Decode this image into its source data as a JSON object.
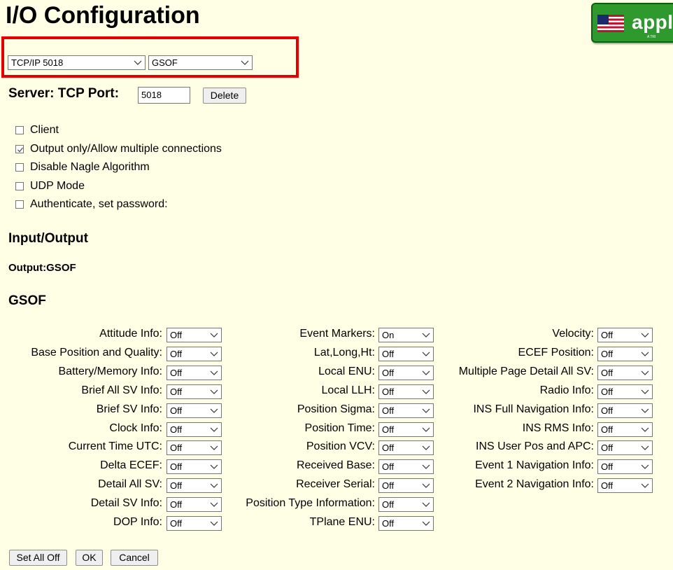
{
  "title": "I/O Configuration",
  "logo": {
    "text": "appl",
    "subtext": "A TRI"
  },
  "port_selector": {
    "selected": "TCP/IP 5018"
  },
  "format_selector": {
    "selected": "GSOF"
  },
  "server": {
    "label": "Server: TCP Port:",
    "port": "5018",
    "delete_label": "Delete"
  },
  "options": [
    {
      "label": "Client",
      "checked": false
    },
    {
      "label": "Output only/Allow multiple connections",
      "checked": true
    },
    {
      "label": "Disable Nagle Algorithm",
      "checked": false
    },
    {
      "label": "UDP Mode",
      "checked": false
    },
    {
      "label": "Authenticate, set password:",
      "checked": false
    }
  ],
  "input_output_heading": "Input/Output",
  "output_line": "Output:GSOF",
  "gsof_heading": "GSOF",
  "gsof": {
    "col1": [
      {
        "label": "Attitude Info:",
        "value": "Off"
      },
      {
        "label": "Base Position and Quality:",
        "value": "Off"
      },
      {
        "label": "Battery/Memory Info:",
        "value": "Off"
      },
      {
        "label": "Brief All SV Info:",
        "value": "Off"
      },
      {
        "label": "Brief SV Info:",
        "value": "Off"
      },
      {
        "label": "Clock Info:",
        "value": "Off"
      },
      {
        "label": "Current Time UTC:",
        "value": "Off"
      },
      {
        "label": "Delta ECEF:",
        "value": "Off"
      },
      {
        "label": "Detail All SV:",
        "value": "Off"
      },
      {
        "label": "Detail SV Info:",
        "value": "Off"
      },
      {
        "label": "DOP Info:",
        "value": "Off"
      }
    ],
    "col2": [
      {
        "label": "Event Markers:",
        "value": "On"
      },
      {
        "label": "Lat,Long,Ht:",
        "value": "Off"
      },
      {
        "label": "Local ENU:",
        "value": "Off"
      },
      {
        "label": "Local LLH:",
        "value": "Off"
      },
      {
        "label": "Position Sigma:",
        "value": "Off"
      },
      {
        "label": "Position Time:",
        "value": "Off"
      },
      {
        "label": "Position VCV:",
        "value": "Off"
      },
      {
        "label": "Received Base:",
        "value": "Off"
      },
      {
        "label": "Receiver Serial:",
        "value": "Off"
      },
      {
        "label": "Position Type Information:",
        "value": "Off"
      },
      {
        "label": "TPlane ENU:",
        "value": "Off"
      }
    ],
    "col3": [
      {
        "label": "Velocity:",
        "value": "Off"
      },
      {
        "label": "ECEF Position:",
        "value": "Off"
      },
      {
        "label": "Multiple Page Detail All SV:",
        "value": "Off"
      },
      {
        "label": "Radio Info:",
        "value": "Off"
      },
      {
        "label": "INS Full Navigation Info:",
        "value": "Off"
      },
      {
        "label": "INS RMS Info:",
        "value": "Off"
      },
      {
        "label": "INS User Pos and APC:",
        "value": "Off"
      },
      {
        "label": "Event 1 Navigation Info:",
        "value": "Off"
      },
      {
        "label": "Event 2 Navigation Info:",
        "value": "Off"
      }
    ]
  },
  "buttons": {
    "set_all_off": "Set All Off",
    "ok": "OK",
    "cancel": "Cancel"
  },
  "colors": {
    "background": "#ffffe6",
    "highlight": "#e60000",
    "logo_green": "#2e9a2e"
  }
}
